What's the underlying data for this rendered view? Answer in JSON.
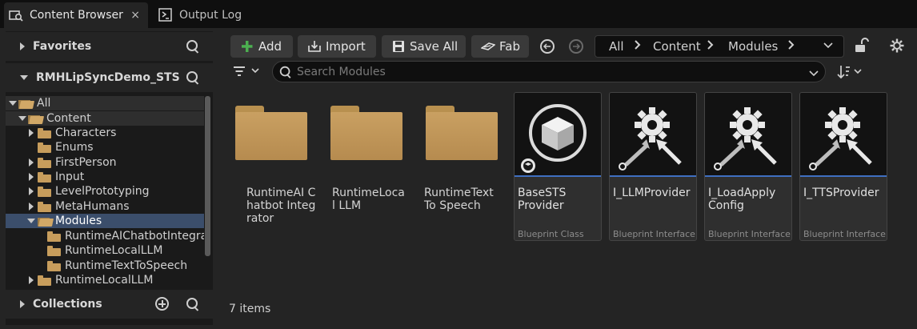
{
  "tabs": [
    {
      "label": "Content Browser",
      "close": "×"
    },
    {
      "label": "Output Log"
    }
  ],
  "sidebar": {
    "favorites_label": "Favorites",
    "project_label": "RMHLipSyncDemo_STS",
    "collections_label": "Collections",
    "tree": [
      {
        "label": "All"
      },
      {
        "label": "Content"
      },
      {
        "label": "Characters"
      },
      {
        "label": "Enums"
      },
      {
        "label": "FirstPerson"
      },
      {
        "label": "Input"
      },
      {
        "label": "LevelPrototyping"
      },
      {
        "label": "MetaHumans"
      },
      {
        "label": "Modules"
      },
      {
        "label": "RuntimeAIChatbotIntegra"
      },
      {
        "label": "RuntimeLocalLLM"
      },
      {
        "label": "RuntimeTextToSpeech"
      },
      {
        "label": "RuntimeLocalLLM"
      }
    ]
  },
  "toolbar": {
    "add_label": "Add",
    "import_label": "Import",
    "save_all_label": "Save All",
    "fab_label": "Fab"
  },
  "breadcrumb": [
    "All",
    "Content",
    "Modules"
  ],
  "search": {
    "placeholder": "Search Modules"
  },
  "folders": [
    {
      "name": "RuntimeAI Chatbot Integrator"
    },
    {
      "name": "RuntimeLocal LLM"
    },
    {
      "name": "RuntimeTextTo Speech"
    }
  ],
  "assets": [
    {
      "name": "BaseSTS Provider",
      "type": "Blueprint Class",
      "icon": "cube-icon"
    },
    {
      "name": "I_LLMProvider",
      "type": "Blueprint Interface",
      "icon": "gear-icon"
    },
    {
      "name": "I_LoadApply Config",
      "type": "Blueprint Interface",
      "icon": "gear-icon"
    },
    {
      "name": "I_TTSProvider",
      "type": "Blueprint Interface",
      "icon": "gear-icon"
    }
  ],
  "status": {
    "item_count": "7 items"
  },
  "colors": {
    "accent": "#3f6fc1",
    "folder": "#c9a062",
    "selection": "#3b4e6b"
  }
}
